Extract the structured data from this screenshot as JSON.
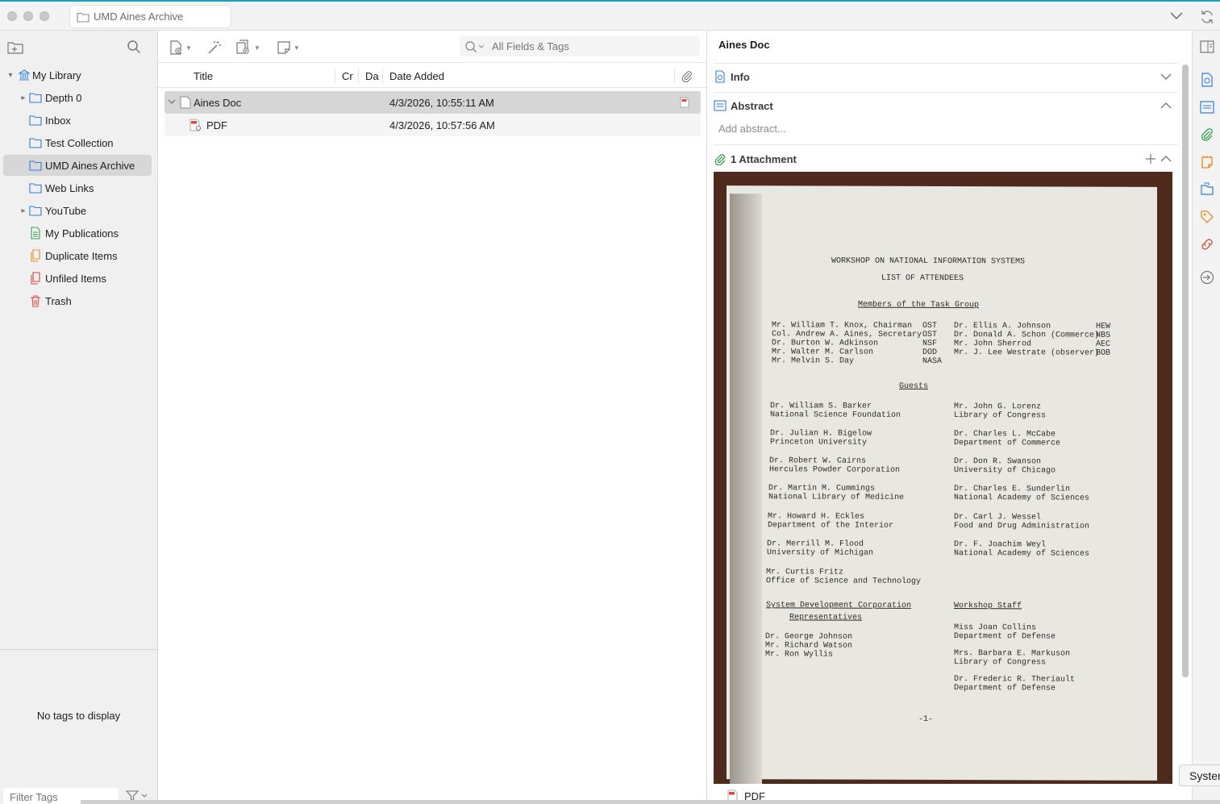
{
  "window": {
    "tab_title": "UMD Aines Archive"
  },
  "left_pane": {
    "tree": [
      {
        "label": "My Library",
        "icon": "library-icon"
      },
      {
        "label": "Depth 0",
        "icon": "folder-icon"
      },
      {
        "label": "Inbox",
        "icon": "folder-icon"
      },
      {
        "label": "Test Collection",
        "icon": "folder-icon"
      },
      {
        "label": "UMD Aines Archive",
        "icon": "folder-icon"
      },
      {
        "label": "Web Links",
        "icon": "folder-icon"
      },
      {
        "label": "YouTube",
        "icon": "folder-icon"
      },
      {
        "label": "My Publications",
        "icon": "publications-icon"
      },
      {
        "label": "Duplicate Items",
        "icon": "duplicate-icon"
      },
      {
        "label": "Unfiled Items",
        "icon": "unfiled-icon"
      },
      {
        "label": "Trash",
        "icon": "trash-icon"
      }
    ],
    "selected": "UMD Aines Archive",
    "no_tags": "No tags to display",
    "filter_placeholder": "Filter Tags"
  },
  "middle_pane": {
    "search_placeholder": "All Fields & Tags",
    "columns": {
      "title": "Title",
      "creator": "Cr",
      "date": "Da",
      "date_added": "Date Added"
    },
    "items": [
      {
        "title": "Aines Doc",
        "date_added": "4/3/2026, 10:55:11 AM"
      },
      {
        "title": "PDF",
        "date_added": "4/3/2026, 10:57:56 AM"
      }
    ]
  },
  "right_pane": {
    "title": "Aines Doc",
    "info": "Info",
    "abstract": "Abstract",
    "abstract_placeholder": "Add abstract...",
    "attachments": "1 Attachment",
    "attachment_name": "PDF"
  },
  "document": {
    "heading1": "WORKSHOP ON NATIONAL INFORMATION SYSTEMS",
    "heading2": "LIST OF ATTENDEES",
    "task_group_heading": "Members of the Task Group",
    "task_left": [
      {
        "name": "Mr. William T. Knox, Chairman",
        "org": "OST"
      },
      {
        "name": "Col. Andrew A. Aines, Secretary",
        "org": "OST"
      },
      {
        "name": "Dr. Burton W. Adkinson",
        "org": "NSF"
      },
      {
        "name": "Mr. Walter M. Carlson",
        "org": "DOD"
      },
      {
        "name": "Mr. Melvin S. Day",
        "org": "NASA"
      }
    ],
    "task_right": [
      {
        "name": "Dr. Ellis A. Johnson",
        "org": "HEW"
      },
      {
        "name": "Dr. Donald A. Schon (Commerce)",
        "org": "NBS"
      },
      {
        "name": "Mr. John Sherrod",
        "org": "AEC"
      },
      {
        "name": "Mr. J. Lee Westrate (observer)",
        "org": "BOB"
      }
    ],
    "guests_heading": "Guests",
    "guests_left": [
      {
        "name": "Dr. William S. Barker",
        "org": "National Science Foundation"
      },
      {
        "name": "Dr. Julian H. Bigelow",
        "org": "Princeton University"
      },
      {
        "name": "Dr. Robert W. Cairns",
        "org": "Hercules Powder Corporation"
      },
      {
        "name": "Dr. Martin M. Cummings",
        "org": "National Library of Medicine"
      },
      {
        "name": "Mr. Howard H. Eckles",
        "org": "Department of the Interior"
      },
      {
        "name": "Dr. Merrill M. Flood",
        "org": "University of Michigan"
      },
      {
        "name": "Mr. Curtis Fritz",
        "org": "Office of Science and Technology"
      }
    ],
    "guests_right": [
      {
        "name": "Mr. John G. Lorenz",
        "org": "Library of Congress"
      },
      {
        "name": "Dr. Charles L. McCabe",
        "org": "Department of Commerce"
      },
      {
        "name": "Dr. Don R. Swanson",
        "org": "University of Chicago"
      },
      {
        "name": "Dr. Charles E. Sunderlin",
        "org": "National Academy of Sciences"
      },
      {
        "name": "Dr. Carl J. Wessel",
        "org": "Food and Drug Administration"
      },
      {
        "name": "Dr. F. Joachim Weyl",
        "org": "National Academy of Sciences"
      }
    ],
    "sdc_heading": "System Development Corporation",
    "sdc_heading2": "Representatives",
    "sdc": [
      "Dr. George Johnson",
      "Mr. Richard Watson",
      "Mr. Ron Wyllis"
    ],
    "staff_heading": "Workshop Staff",
    "staff": [
      {
        "name": "Miss Joan Collins",
        "org": "Department of Defense"
      },
      {
        "name": "Mrs. Barbara E. Markuson",
        "org": "Library of Congress"
      },
      {
        "name": "Dr. Frederic R. Theriault",
        "org": "Department of Defense"
      }
    ],
    "page_number": "-1-"
  },
  "tooltip": "Syster",
  "colors": {
    "accent": "#1aa3b8",
    "icon_blue": "#2f7fd8",
    "icon_orange": "#e78b1e",
    "icon_red": "#d84a3a",
    "icon_green": "#3aa352"
  }
}
